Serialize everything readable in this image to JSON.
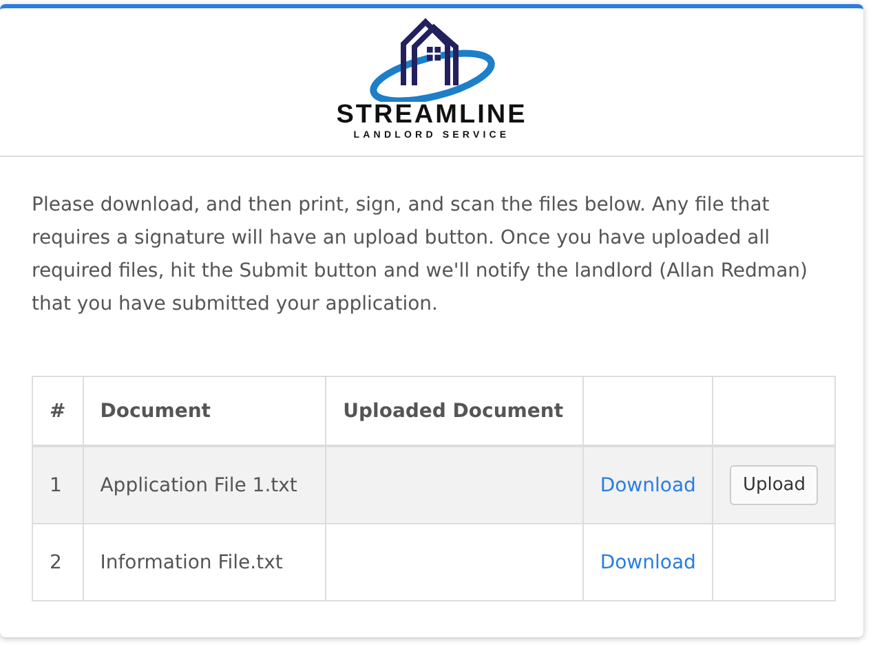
{
  "logo": {
    "name": "STREAMLINE",
    "tagline": "LANDLORD SERVICE"
  },
  "instructions": "Please download, and then print, sign, and scan the files below. Any file that requires a signature will have an upload button. Once you have uploaded all required files, hit the Submit button and we'll notify the landlord (Allan Redman) that you have submitted your application.",
  "table": {
    "columns": [
      "#",
      "Document",
      "Uploaded Document"
    ],
    "rows": [
      {
        "number": "1",
        "document": "Application File 1.txt",
        "download": "Download",
        "upload": "Upload",
        "highlighted": true
      },
      {
        "number": "2",
        "document": "Information File.txt",
        "download": "Download",
        "highlighted": false
      }
    ]
  }
}
